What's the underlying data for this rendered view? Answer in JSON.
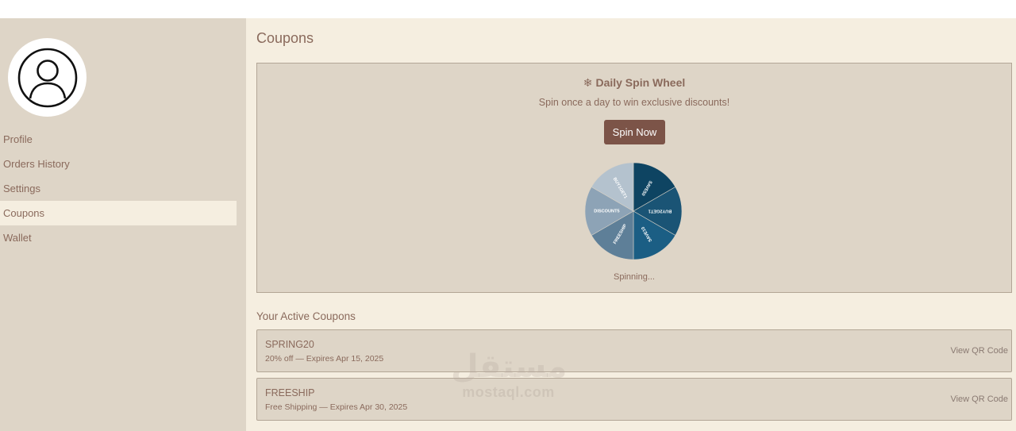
{
  "sidebar": {
    "items": [
      {
        "label": "Profile"
      },
      {
        "label": "Orders History"
      },
      {
        "label": "Settings"
      },
      {
        "label": "Coupons"
      },
      {
        "label": "Wallet"
      }
    ],
    "active_item": "Coupons"
  },
  "main": {
    "title": "Coupons",
    "spin": {
      "icon": "gear-icon",
      "title": "Daily Spin Wheel",
      "subtitle": "Spin once a day to win exclusive discounts!",
      "button_label": "Spin Now",
      "status": "Spinning...",
      "segments": [
        {
          "label": "SAVE50",
          "color": "#0e4462"
        },
        {
          "label": "BUY2GET1",
          "color": "#1a5475"
        },
        {
          "label": "SAVE10",
          "color": "#1b5e84"
        },
        {
          "label": "FREESHIP",
          "color": "#5e7f98"
        },
        {
          "label": "DISCOUNT5",
          "color": "#8da3b6"
        },
        {
          "label": "BUY1GET1",
          "color": "#b4c2ce"
        }
      ]
    },
    "active_title": "Your Active Coupons",
    "coupons": [
      {
        "code": "SPRING20",
        "desc": "20% off — Expires Apr 15, 2025",
        "action": "View QR Code"
      },
      {
        "code": "FREESHIP",
        "desc": "Free Shipping — Expires Apr 30, 2025",
        "action": "View QR Code"
      }
    ]
  },
  "watermark": {
    "arabic": "مستقل",
    "latin": "mostaql.com"
  },
  "colors": {
    "sidebar_bg": "#ded5c7",
    "main_bg": "#f5eee0",
    "accent": "#7c5448",
    "text": "#8a6a5c"
  }
}
